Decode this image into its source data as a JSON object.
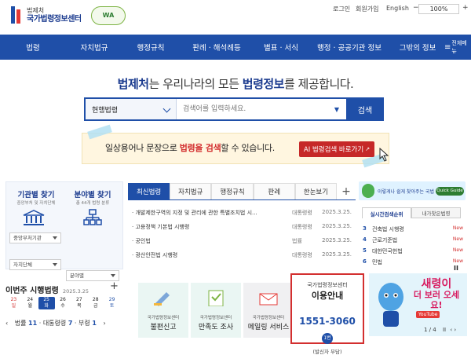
{
  "header": {
    "logo_sub": "법제처",
    "logo_main": "국가법령정보센터",
    "wa_badge": "WA",
    "utility": [
      "로그인",
      "회원가입",
      "English"
    ],
    "zoom": "100%"
  },
  "nav": {
    "items": [
      "법령",
      "자치법규",
      "행정규칙",
      "판례 · 해석례등",
      "별표 · 서식",
      "행정 · 공공기관 정보",
      "그밖의 정보"
    ],
    "menu_label": "전체메뉴"
  },
  "hero": {
    "pre": "법제처",
    "mid": "는 우리나라의 모든 ",
    "bold": "법령정보",
    "post": "를 제공합니다."
  },
  "search": {
    "select_value": "현행법령",
    "placeholder": "검색어를 입력하세요.",
    "button": "검색"
  },
  "banner": {
    "t1": "일상용어나 문장으로 ",
    "t2": "법령을 검색",
    "t3": "할 수 있습니다.",
    "button": "AI 법령검색 바로가기"
  },
  "quick": {
    "agency_title": "기관별 찾기",
    "agency_sub": "중앙부처 및 자치단체",
    "field_title": "분야별 찾기",
    "field_sub": "총 44개 법령 분류",
    "agency_select": "중앙부처기관",
    "local_select": "자치단체",
    "field_select": "분야별"
  },
  "tabs": [
    "최신법령",
    "자치법규",
    "행정규칙",
    "판례",
    "한눈보기"
  ],
  "tab_plus": "+",
  "laws": [
    {
      "title": "· 개발제한구역의 지정 및 관리에 관한 특별조치법 시...",
      "kind": "대통령령",
      "date": "2025.3.25."
    },
    {
      "title": "· 고용정책 기본법 시행령",
      "kind": "대통령령",
      "date": "2025.3.25."
    },
    {
      "title": "· 공인법",
      "kind": "법률",
      "date": "2025.3.25."
    },
    {
      "title": "· 광산안전법 시행령",
      "kind": "대통령령",
      "date": "2025.3.25."
    }
  ],
  "right": {
    "banner_text": "이렇게나 쉽게 찾아주는 국법",
    "quick_guide": "Quick Guide",
    "tabs": [
      "실시간검색순위",
      "내가찾은법령"
    ],
    "ranks": [
      {
        "n": "3",
        "label": "건축법 시행령",
        "badge": "New"
      },
      {
        "n": "4",
        "label": "근로기준법",
        "badge": "New"
      },
      {
        "n": "5",
        "label": "대한민국헌법",
        "badge": "New"
      },
      {
        "n": "6",
        "label": "민법",
        "badge": "New"
      }
    ],
    "pause": "II"
  },
  "calendar": {
    "title": "이번주 시행법령",
    "date": "2025.3.25",
    "plus": "+",
    "days": [
      {
        "d": "23",
        "w": "일"
      },
      {
        "d": "24",
        "w": "월"
      },
      {
        "d": "25",
        "w": "화"
      },
      {
        "d": "26",
        "w": "수"
      },
      {
        "d": "27",
        "w": "목"
      },
      {
        "d": "28",
        "w": "금"
      },
      {
        "d": "29",
        "w": "토"
      }
    ],
    "foot_law": "법률",
    "foot_law_n": "11",
    "foot_decree": "대통령령",
    "foot_decree_n": "7",
    "foot_min": "부령",
    "foot_min_n": "1"
  },
  "services": [
    {
      "sub": "국가법령정보센터",
      "main": "불편신고"
    },
    {
      "sub": "국가법령정보센터",
      "main": "만족도 조사"
    },
    {
      "sub": "국가법령정보센터",
      "main": "메일링 서비스"
    }
  ],
  "contact": {
    "sub": "국가법령정보센터",
    "main": "이용안내",
    "phone": "1551-3060",
    "badge": "1번",
    "note": "(발신자 부담)"
  },
  "promo": {
    "line1": "새령이",
    "line2": "더 보러 오세요!",
    "channel": "YouTube",
    "pager": "1 / 4"
  }
}
